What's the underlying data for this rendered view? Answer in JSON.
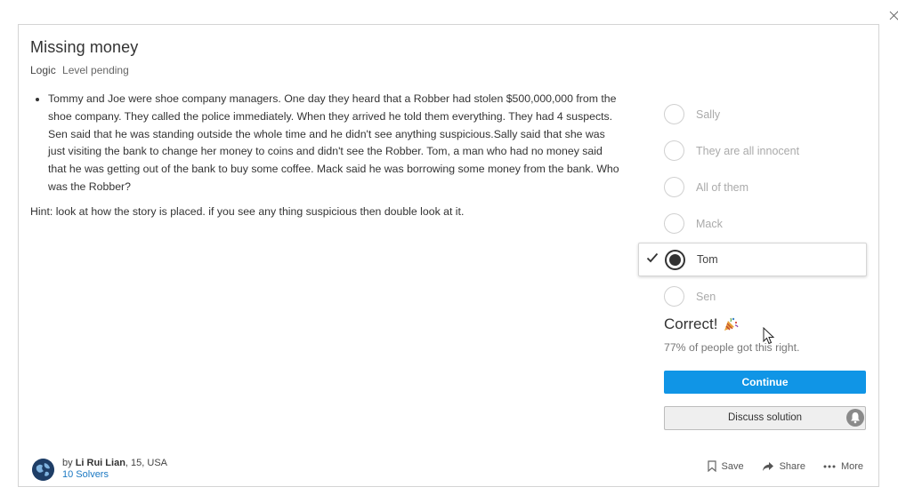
{
  "problem": {
    "title": "Missing money",
    "topic": "Logic",
    "level": "Level pending",
    "body": "Tommy and Joe were shoe company managers. One day they heard that a Robber had stolen $500,000,000 from the shoe company. They called the police immediately. When they arrived he told them everything. They had 4 suspects. Sen said that he was standing outside the whole time and he didn't see anything suspicious.Sally said that she was just visiting the bank to change her money to coins and didn't see the Robber. Tom, a man who had no money said that he was getting out of the bank to buy some coffee. Mack said he was borrowing some money from the bank. Who was the Robber?",
    "hint": "Hint: look at how the story is placed. if you see any thing suspicious then double look at it."
  },
  "options": [
    {
      "label": "Sally",
      "selected": false
    },
    {
      "label": "They are all innocent",
      "selected": false
    },
    {
      "label": "All of them",
      "selected": false
    },
    {
      "label": "Mack",
      "selected": false
    },
    {
      "label": "Tom",
      "selected": true
    },
    {
      "label": "Sen",
      "selected": false
    }
  ],
  "result": {
    "headline": "Correct!",
    "stats": "77% of people got this right."
  },
  "buttons": {
    "continue": "Continue",
    "discuss": "Discuss solution"
  },
  "author": {
    "by": "by",
    "name": "Li Rui Lian",
    "details": ", 15, USA",
    "solvers": "10 Solvers"
  },
  "actions": {
    "save": "Save",
    "share": "Share",
    "more": "More"
  },
  "colors": {
    "accent": "#1095e6",
    "link": "#1a78c2"
  }
}
